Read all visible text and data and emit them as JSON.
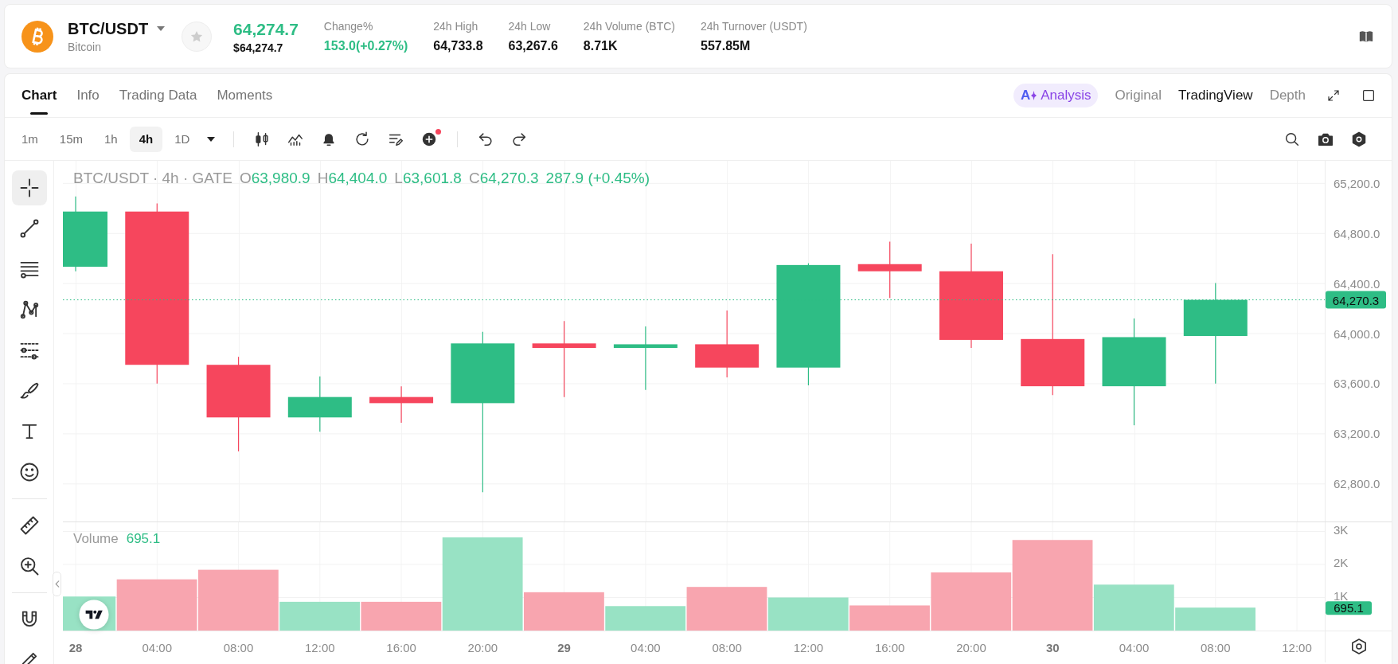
{
  "header": {
    "symbol": "BTC/USDT",
    "name": "Bitcoin",
    "favorite": false,
    "rising": true,
    "price": "64,274.7",
    "price_usd": "$64,274.7",
    "stats": [
      {
        "label": "Change%",
        "value": "153.0(+0.27%)",
        "kind": "up"
      },
      {
        "label": "24h High",
        "value": "64,733.8",
        "kind": "plain"
      },
      {
        "label": "24h Low",
        "value": "63,267.6",
        "kind": "plain"
      },
      {
        "label": "24h Volume (BTC)",
        "value": "8.71K",
        "kind": "plain"
      },
      {
        "label": "24h Turnover (USDT)",
        "value": "557.85M",
        "kind": "plain"
      }
    ]
  },
  "view_tabs": [
    {
      "label": "Chart",
      "selected": true
    },
    {
      "label": "Info",
      "selected": false
    },
    {
      "label": "Trading Data",
      "selected": false
    },
    {
      "label": "Moments",
      "selected": false
    }
  ],
  "chart_views": [
    {
      "label": "Analysis",
      "kind": "ai",
      "mark": "A",
      "selected": false
    },
    {
      "label": "Original",
      "kind": "text",
      "selected": false
    },
    {
      "label": "TradingView",
      "kind": "text",
      "selected": true
    },
    {
      "label": "Depth",
      "kind": "text",
      "selected": false
    }
  ],
  "intervals": [
    {
      "label": "1m",
      "selected": false
    },
    {
      "label": "15m",
      "selected": false
    },
    {
      "label": "1h",
      "selected": false
    },
    {
      "label": "4h",
      "selected": true
    },
    {
      "label": "1D",
      "selected": false
    }
  ],
  "indicator_notice": true,
  "drawing_tool_groups": [
    {
      "tools": [
        {
          "kind": "crosshair",
          "selected": true
        },
        {
          "kind": "trend-line",
          "selected": false
        },
        {
          "kind": "parallel-lines",
          "selected": false
        },
        {
          "kind": "pattern",
          "selected": false
        },
        {
          "kind": "fib",
          "selected": false
        },
        {
          "kind": "brush",
          "selected": false
        },
        {
          "kind": "text",
          "selected": false
        },
        {
          "kind": "emoji",
          "selected": false
        }
      ]
    },
    {
      "tools": [
        {
          "kind": "ruler",
          "selected": false
        },
        {
          "kind": "zoom-in",
          "selected": false
        }
      ]
    },
    {
      "tools": [
        {
          "kind": "magnet",
          "selected": false
        },
        {
          "kind": "pencil",
          "selected": false
        }
      ]
    }
  ],
  "price_pane": {
    "legend": {
      "title": "BTC/USDT · 4h · GATE",
      "rising": true,
      "ohlc": [
        {
          "key": "O",
          "value": "63,980.9"
        },
        {
          "key": "H",
          "value": "64,404.0"
        },
        {
          "key": "L",
          "value": "63,601.8"
        },
        {
          "key": "C",
          "value": "64,270.3"
        }
      ],
      "change": "287.9 (+0.45%)"
    },
    "price_axis": [
      "65,200.0",
      "64,800.0",
      "64,400.0",
      "64,000.0",
      "63,600.0",
      "63,200.0",
      "62,800.0"
    ],
    "last_price_tag": "64,270.3"
  },
  "volume_pane": {
    "legend": {
      "value": "695.1"
    },
    "chart_data": {
      "type": "bar",
      "categories": [
        "28",
        "04:00",
        "08:00",
        "12:00",
        "16:00",
        "20:00",
        "29",
        "04:00",
        "08:00",
        "12:00",
        "16:00",
        "20:00",
        "30",
        "04:00",
        "08:00",
        "12:00"
      ],
      "series": [
        {
          "name": "Volume",
          "values": [
            1030,
            1550,
            1840,
            870,
            870,
            2820,
            1160,
            740,
            1320,
            1000,
            760,
            1760,
            2740,
            1390,
            695.1,
            null
          ]
        }
      ],
      "ylim": [
        0,
        3300
      ],
      "yticks": [
        {
          "value": 1000,
          "label": "1K"
        },
        {
          "value": 2000,
          "label": "2K"
        },
        {
          "value": 3000,
          "label": "3K"
        }
      ],
      "grid": true,
      "annotations": [
        "695.1"
      ]
    }
  }
}
